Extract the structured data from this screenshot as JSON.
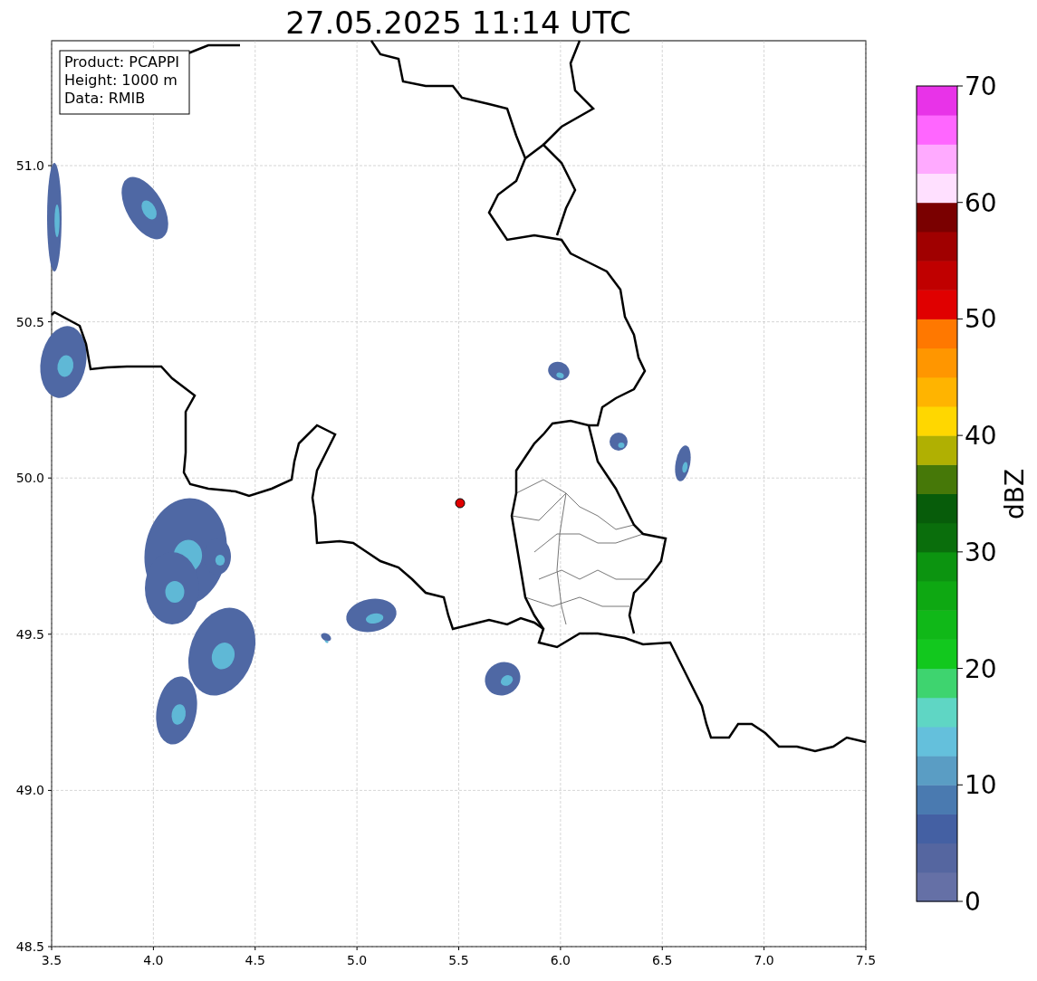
{
  "title": "27.05.2025 11:14 UTC",
  "info_box": [
    "Product: PCAPPI",
    "Height: 1000 m",
    "Data: RMIB"
  ],
  "x_ticks": [
    "3.5",
    "4.0",
    "4.5",
    "5.0",
    "5.5",
    "6.0",
    "6.5",
    "7.0",
    "7.5"
  ],
  "y_ticks": [
    "51.0",
    "50.5",
    "50.0",
    "49.5",
    "49.0",
    "48.5"
  ],
  "colorbar": {
    "label": "dBZ",
    "ticks": [
      "70",
      "60",
      "50",
      "40",
      "30",
      "20",
      "10",
      "0"
    ],
    "segments": [
      {
        "color": "#6570a6"
      },
      {
        "color": "#5566a0"
      },
      {
        "color": "#4460a3"
      },
      {
        "color": "#4a7ab0"
      },
      {
        "color": "#5a9dc4"
      },
      {
        "color": "#64c0dc"
      },
      {
        "color": "#5fd6c4"
      },
      {
        "color": "#3ed46f"
      },
      {
        "color": "#12c81e"
      },
      {
        "color": "#10b818"
      },
      {
        "color": "#0ea812"
      },
      {
        "color": "#0c9410"
      },
      {
        "color": "#0a6e0c"
      },
      {
        "color": "#075c0a"
      },
      {
        "color": "#467808"
      },
      {
        "color": "#b0b002"
      },
      {
        "color": "#ffd700"
      },
      {
        "color": "#ffb400"
      },
      {
        "color": "#ff9600"
      },
      {
        "color": "#ff7800"
      },
      {
        "color": "#e00000"
      },
      {
        "color": "#c00000"
      },
      {
        "color": "#a00000"
      },
      {
        "color": "#7a0000"
      },
      {
        "color": "#ffe0ff"
      },
      {
        "color": "#ffaaff"
      },
      {
        "color": "#ff66ff"
      },
      {
        "color": "#e833e8"
      }
    ]
  }
}
